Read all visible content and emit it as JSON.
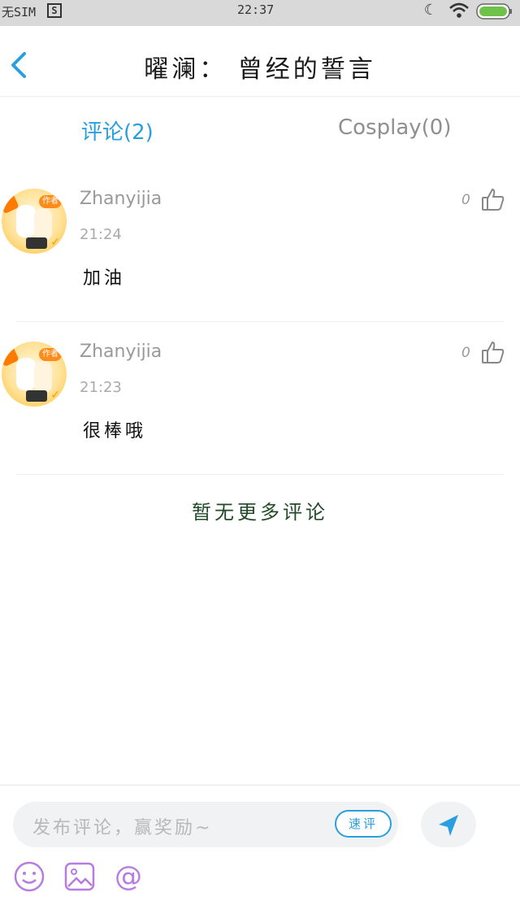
{
  "status_bar": {
    "sim": "无SIM",
    "app_icon": "S",
    "time": "22:37",
    "icons": [
      "moon-icon",
      "wifi-icon",
      "battery-icon"
    ]
  },
  "header": {
    "title": "曜澜： 曾经的誓言",
    "back_icon": "chevron-left-icon"
  },
  "tabs": [
    {
      "label": "评论(2)",
      "active": true
    },
    {
      "label": "Cosplay(0)",
      "active": false
    }
  ],
  "comments": [
    {
      "user": "Zhanyijia",
      "time": "21:24",
      "text": "加油",
      "likes": "0",
      "badge": "作者"
    },
    {
      "user": "Zhanyijia",
      "time": "21:23",
      "text": "很棒哦",
      "likes": "0",
      "badge": "作者"
    }
  ],
  "footer_note": "暂无更多评论",
  "composer": {
    "placeholder": "发布评论，赢奖励~",
    "quick_comment": "速评",
    "send_icon": "send-icon",
    "tools": [
      "emoji-icon",
      "image-icon",
      "mention-icon"
    ]
  },
  "colors": {
    "accent": "#2a9fe0",
    "muted": "#999999",
    "note": "#234a28",
    "tool": "#b87be0"
  }
}
